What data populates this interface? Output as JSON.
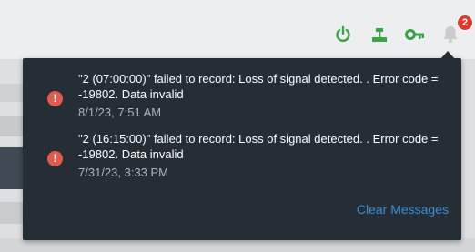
{
  "toolbar": {
    "icons": [
      "power-icon",
      "network-icon",
      "key-icon",
      "bell-icon"
    ],
    "accent_green": "#3aa34a",
    "notification_count": "2"
  },
  "notifications": {
    "messages": [
      {
        "text": "\"2 (07:00:00)\" failed to record: Loss of signal detected. . Error code = -19802. Data invalid",
        "time": "8/1/23, 7:51 AM",
        "icon": "error-icon"
      },
      {
        "text": "\"2 (16:15:00)\" failed to record: Loss of signal detected. . Error code = -19802. Data invalid",
        "time": "7/31/23, 3:33 PM",
        "icon": "error-icon"
      }
    ],
    "clear_label": "Clear Messages",
    "error_color": "#e25a4d",
    "link_color": "#3c8ed4"
  }
}
